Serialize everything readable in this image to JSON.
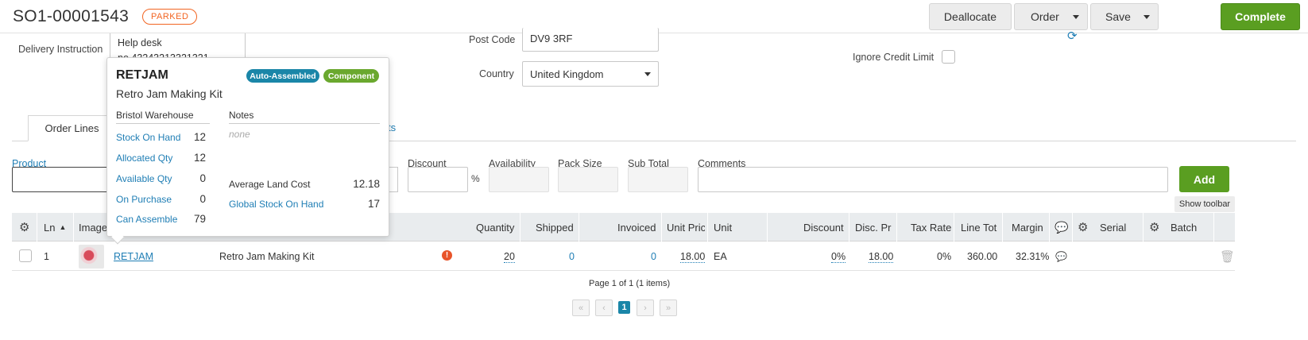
{
  "header": {
    "order_number": "SO1-00001543",
    "status": "PARKED",
    "deallocate": "Deallocate",
    "order": "Order",
    "save": "Save",
    "complete": "Complete"
  },
  "form": {
    "delivery_instruction_label": "Delivery Instruction",
    "delivery_instruction_value": "Help desk\nno 43243213321321",
    "post_code_label": "Post Code",
    "post_code_value": "DV9 3RF",
    "country_label": "Country",
    "country_value": "United Kingdom",
    "ignore_credit_limit_label": "Ignore Credit Limit"
  },
  "tabs": {
    "order_lines": "Order Lines",
    "hidden_tab_fragment": "ts"
  },
  "entry": {
    "product_label": "Product",
    "discount_label": "Discount",
    "percent": "%",
    "availability_label": "Availability",
    "pack_size_label": "Pack Size",
    "sub_total_label": "Sub Total",
    "comments_label": "Comments",
    "add": "Add",
    "show_toolbar": "Show toolbar"
  },
  "table": {
    "headers": {
      "ln": "Ln",
      "image": "Image",
      "quantity": "Quantity",
      "shipped": "Shipped",
      "invoiced": "Invoiced",
      "unit_price": "Unit Pric",
      "unit": "Unit",
      "discount": "Discount",
      "disc_price": "Disc. Pri",
      "tax_rate": "Tax Rate",
      "line_total": "Line Tot",
      "margin": "Margin",
      "serial": "Serial",
      "batch": "Batch"
    },
    "row": {
      "ln": "1",
      "code": "RETJAM",
      "name": "Retro Jam Making Kit",
      "quantity": "20",
      "shipped": "0",
      "invoiced": "0",
      "unit_price": "18.00",
      "unit": "EA",
      "discount": "0%",
      "disc_price": "18.00",
      "tax_rate": "0%",
      "line_total": "360.00",
      "margin": "32.31%"
    }
  },
  "pager": {
    "summary": "Page 1 of 1 (1 items)",
    "current": "1"
  },
  "popup": {
    "code": "RETJAM",
    "name": "Retro Jam Making Kit",
    "badge_auto": "Auto-Assembled",
    "badge_component": "Component",
    "warehouse": "Bristol Warehouse",
    "notes_label": "Notes",
    "notes_value": "none",
    "stock_on_hand_label": "Stock On Hand",
    "stock_on_hand": "12",
    "allocated_label": "Allocated Qty",
    "allocated": "12",
    "available_label": "Available Qty",
    "available": "0",
    "on_purchase_label": "On Purchase",
    "on_purchase": "0",
    "can_assemble_label": "Can Assemble",
    "can_assemble": "79",
    "avg_land_cost_label": "Average Land Cost",
    "avg_land_cost": "12.18",
    "global_stock_label": "Global Stock On Hand",
    "global_stock": "17"
  },
  "colors": {
    "green": "#5a9e21",
    "blue": "#1f7eb5",
    "orange": "#f26522",
    "teal": "#1a86a8",
    "badge_green": "#6aa82e"
  }
}
